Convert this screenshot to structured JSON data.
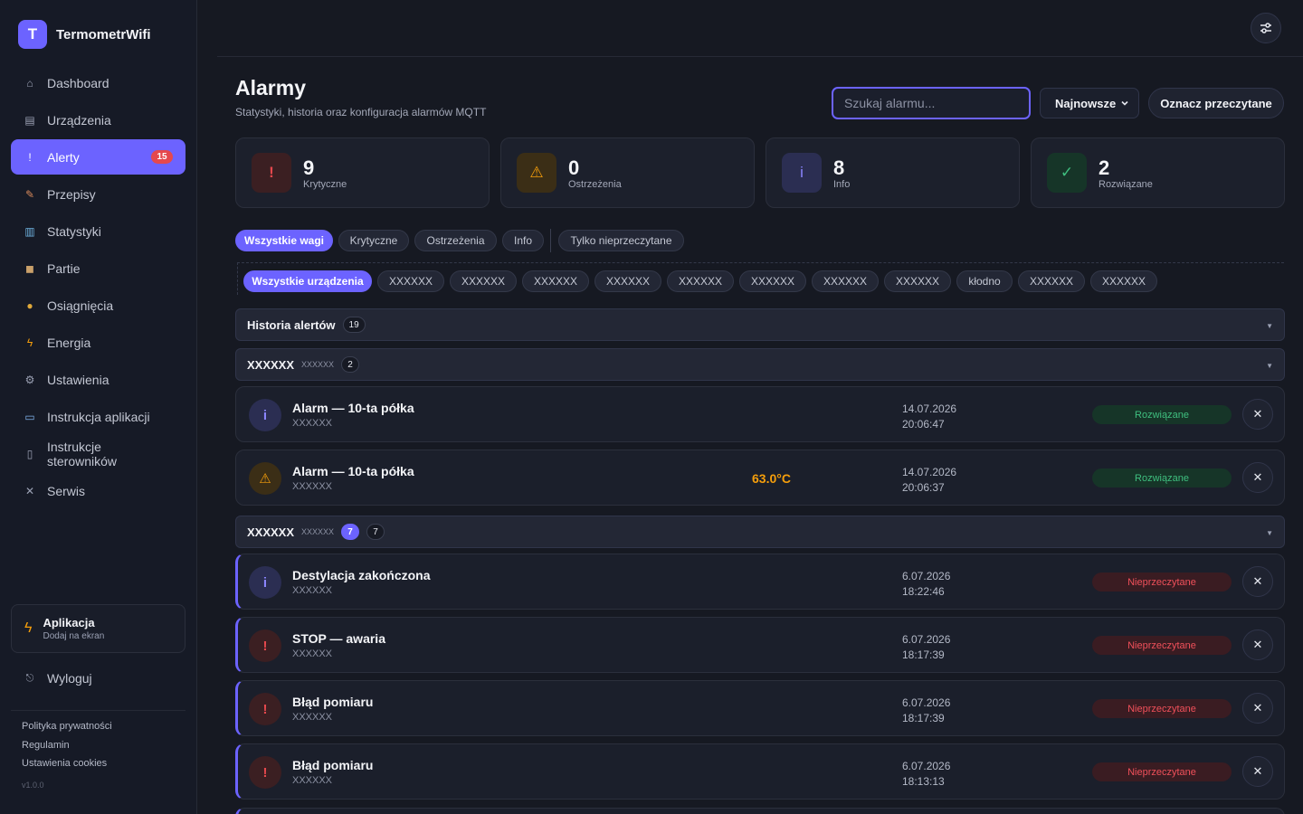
{
  "app": {
    "logo_letter": "T",
    "name": "TermometrWifi"
  },
  "sidebar": {
    "items": [
      {
        "label": "Dashboard",
        "icon": "home-icon",
        "glyph": "⌂"
      },
      {
        "label": "Urządzenia",
        "icon": "devices-icon",
        "glyph": "▤"
      },
      {
        "label": "Alerty",
        "icon": "alert-icon",
        "glyph": "!",
        "badge": "15",
        "active": true
      },
      {
        "label": "Przepisy",
        "icon": "recipe-icon",
        "glyph": "✎"
      },
      {
        "label": "Statystyki",
        "icon": "chart-icon",
        "glyph": "▥"
      },
      {
        "label": "Partie",
        "icon": "box-icon",
        "glyph": "◼"
      },
      {
        "label": "Osiągnięcia",
        "icon": "medal-icon",
        "glyph": "●"
      },
      {
        "label": "Energia",
        "icon": "bolt-icon",
        "glyph": "ϟ"
      },
      {
        "label": "Ustawienia",
        "icon": "gear-icon",
        "glyph": "⚙"
      },
      {
        "label": "Instrukcja aplikacji",
        "icon": "book-icon",
        "glyph": "▭"
      },
      {
        "label": "Instrukcje sterowników",
        "icon": "controller-icon",
        "glyph": "▯"
      },
      {
        "label": "Serwis",
        "icon": "tools-icon",
        "glyph": "✕"
      }
    ],
    "install": {
      "title": "Aplikacja",
      "subtitle": "Dodaj na ekran"
    },
    "logout": "Wyloguj",
    "footer": [
      "Polityka prywatności",
      "Regulamin",
      "Ustawienia cookies"
    ],
    "version": "v1.0.0"
  },
  "header": {
    "title": "Alarmy",
    "subtitle": "Statystyki, historia oraz konfiguracja alarmów MQTT",
    "search_placeholder": "Szukaj alarmu...",
    "sort_value": "Najnowsze",
    "mark_read": "Oznacz przeczytane"
  },
  "stats": [
    {
      "value": "9",
      "label": "Krytyczne",
      "glyph": "!",
      "color": "#e5484d"
    },
    {
      "value": "0",
      "label": "Ostrzeżenia",
      "glyph": "⚠",
      "color": "#f59e0b"
    },
    {
      "value": "8",
      "label": "Info",
      "glyph": "i",
      "color": "#8b85ff"
    },
    {
      "value": "2",
      "label": "Rozwiązane",
      "glyph": "✓",
      "color": "#3fbf7f"
    }
  ],
  "severity_filters": [
    "Wszystkie wagi",
    "Krytyczne",
    "Ostrzeżenia",
    "Info",
    "Tylko nieprzeczytane"
  ],
  "device_filters": [
    "Wszystkie urządzenia",
    "XXXXXX",
    "XXXXXX",
    "XXXXXX",
    "XXXXXX",
    "XXXXXX",
    "XXXXXX",
    "XXXXXX",
    "XXXXXX",
    "kłodno",
    "XXXXXX",
    "XXXXXX"
  ],
  "history": {
    "title": "Historia alertów",
    "count": "19"
  },
  "groups": [
    {
      "name": "XXXXXX",
      "sub": "XXXXXX",
      "count": "2",
      "alerts": [
        {
          "title": "Alarm — 10-ta półka",
          "device": "XXXXXX",
          "date": "14.07.2026",
          "time": "20:06:47",
          "status": "Rozwiązane",
          "type": "info"
        },
        {
          "title": "Alarm — 10-ta półka",
          "device": "XXXXXX",
          "value": "63.0°C",
          "date": "14.07.2026",
          "time": "20:06:37",
          "status": "Rozwiązane",
          "type": "warn"
        }
      ]
    },
    {
      "name": "XXXXXX",
      "sub": "XXXXXX",
      "unread": "7",
      "count": "7",
      "alerts": [
        {
          "title": "Destylacja zakończona",
          "device": "XXXXXX",
          "date": "6.07.2026",
          "time": "18:22:46",
          "status": "Nieprzeczytane",
          "type": "info"
        },
        {
          "title": "STOP — awaria",
          "device": "XXXXXX",
          "date": "6.07.2026",
          "time": "18:17:39",
          "status": "Nieprzeczytane",
          "type": "crit"
        },
        {
          "title": "Błąd pomiaru",
          "device": "XXXXXX",
          "date": "6.07.2026",
          "time": "18:17:39",
          "status": "Nieprzeczytane",
          "type": "crit"
        },
        {
          "title": "Błąd pomiaru",
          "device": "XXXXXX",
          "date": "6.07.2026",
          "time": "18:13:13",
          "status": "Nieprzeczytane",
          "type": "crit"
        }
      ]
    }
  ],
  "icons": {
    "close": "close-icon",
    "caret": "chevron-down-icon",
    "settings": "sliders-icon"
  }
}
